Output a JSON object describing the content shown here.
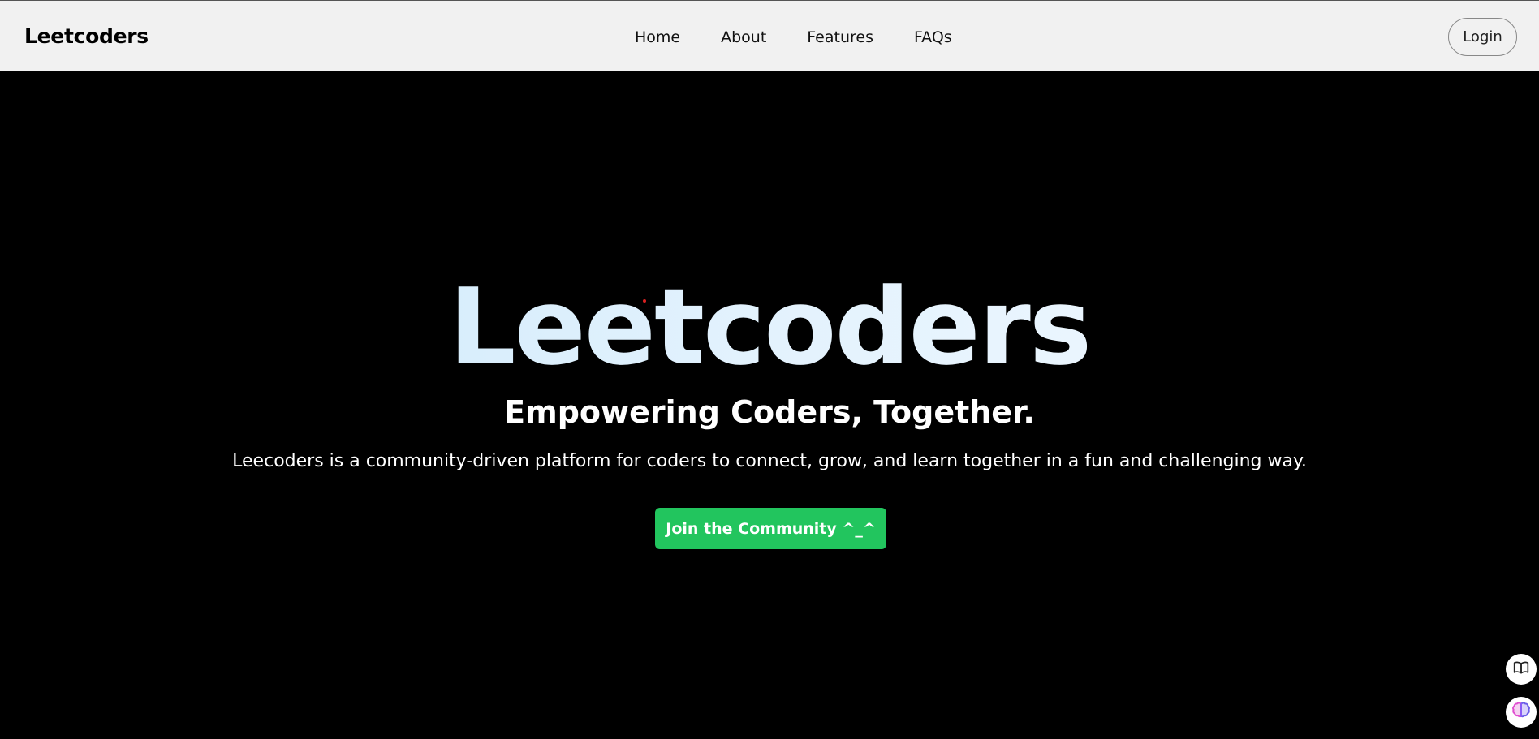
{
  "header": {
    "brand": "Leetcoders",
    "nav": [
      "Home",
      "About",
      "Features",
      "FAQs"
    ],
    "login_label": "Login"
  },
  "hero": {
    "title": "Leetcoders",
    "subtitle": "Empowering Coders, Together.",
    "description": "Leecoders is a community-driven platform for coders to connect, grow, and learn together in a fun and challenging way.",
    "cta_label": "Join the Community ^_^"
  },
  "floating_buttons": [
    {
      "icon": "book-icon"
    },
    {
      "icon": "brain-icon"
    }
  ],
  "colors": {
    "header_bg": "#f1f1f1",
    "hero_bg": "#000000",
    "cta_bg": "#22c55e",
    "title_gradient_start": "#c9e7fb",
    "title_gradient_end": "#f4faff"
  }
}
